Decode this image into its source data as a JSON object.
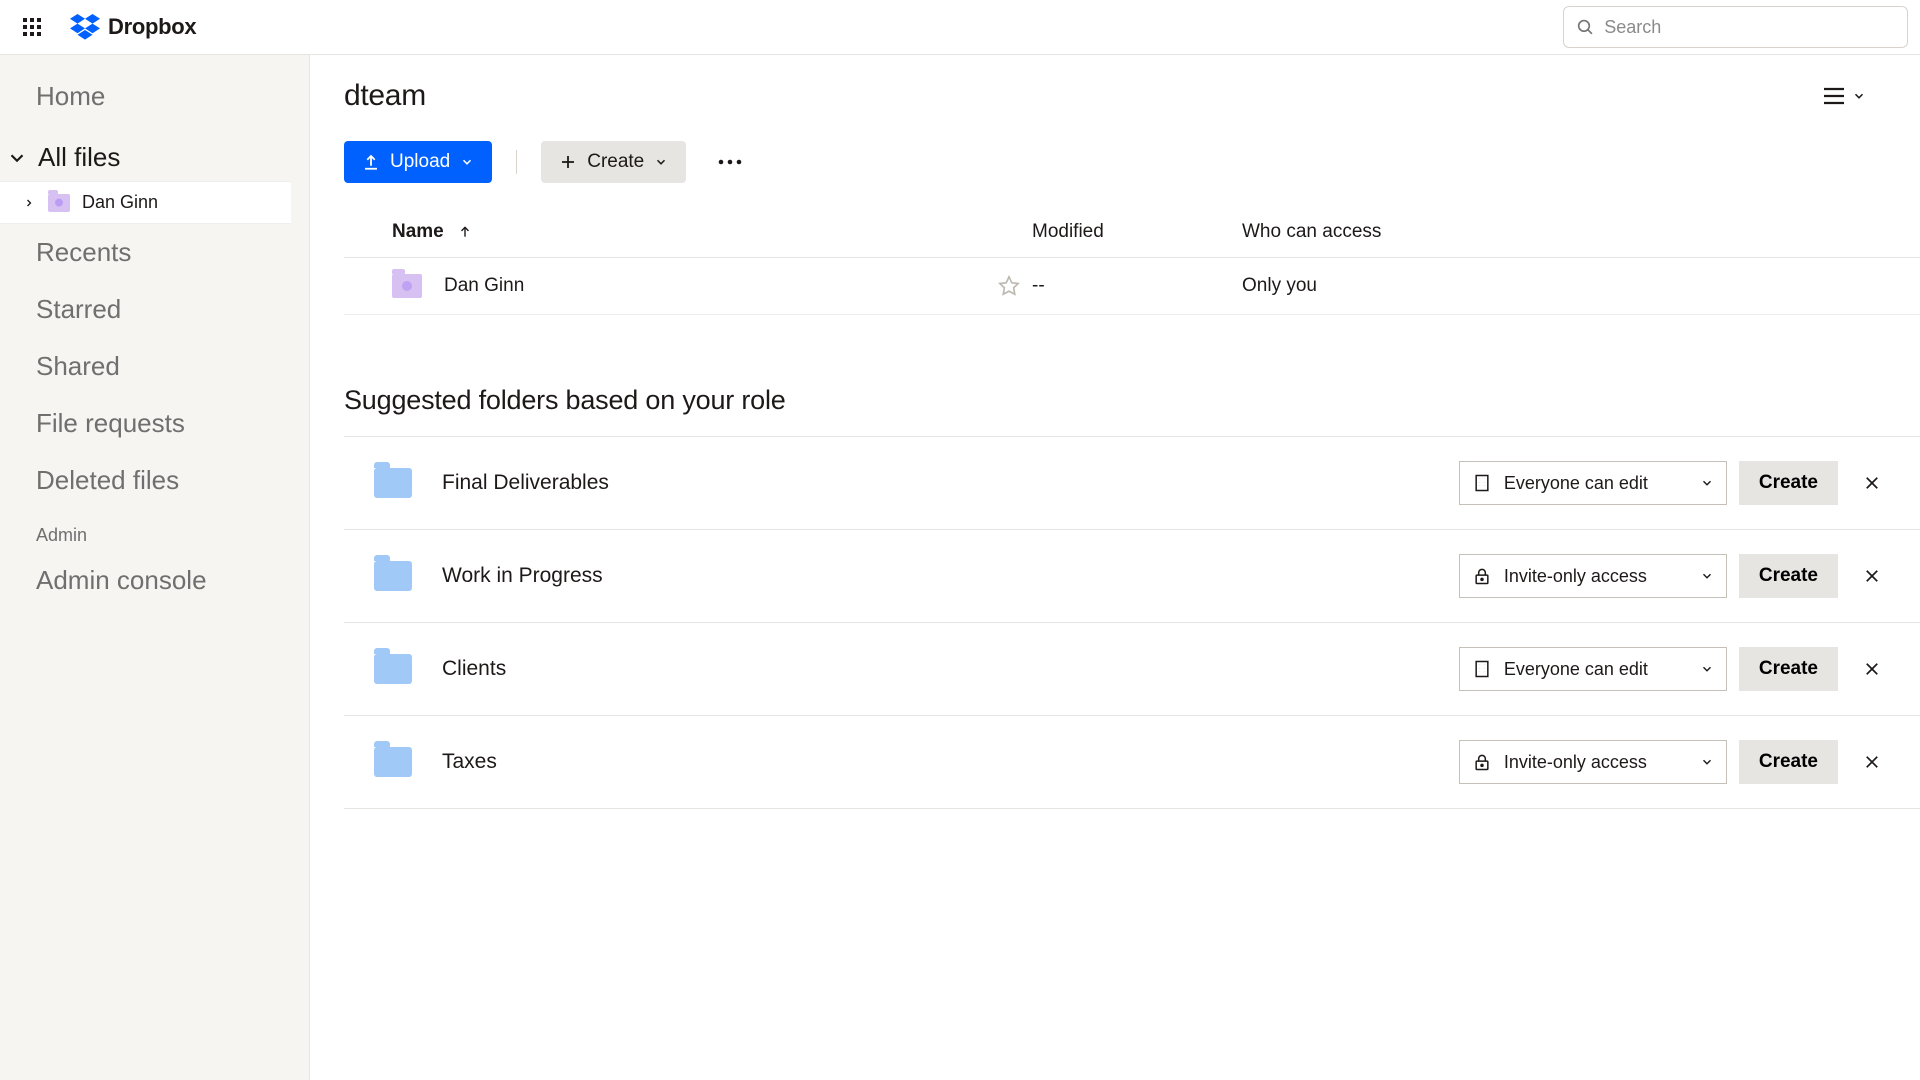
{
  "brand": {
    "name": "Dropbox"
  },
  "search": {
    "placeholder": "Search"
  },
  "sidebar": {
    "home": "Home",
    "all_files": "All files",
    "tree_item": "Dan Ginn",
    "items": [
      "Recents",
      "Starred",
      "Shared",
      "File requests",
      "Deleted files"
    ],
    "admin_label": "Admin",
    "admin_console": "Admin console"
  },
  "page": {
    "title": "dteam",
    "upload_label": "Upload",
    "create_label": "Create"
  },
  "table": {
    "columns": {
      "name": "Name",
      "modified": "Modified",
      "access": "Who can access"
    },
    "rows": [
      {
        "name": "Dan Ginn",
        "modified": "--",
        "access": "Only you"
      }
    ]
  },
  "suggested": {
    "title": "Suggested folders based on your role",
    "create_label": "Create",
    "access_options": {
      "everyone": "Everyone can edit",
      "invite": "Invite-only access"
    },
    "rows": [
      {
        "name": "Final Deliverables",
        "access": "everyone"
      },
      {
        "name": "Work in Progress",
        "access": "invite"
      },
      {
        "name": "Clients",
        "access": "everyone"
      },
      {
        "name": "Taxes",
        "access": "invite"
      }
    ]
  }
}
